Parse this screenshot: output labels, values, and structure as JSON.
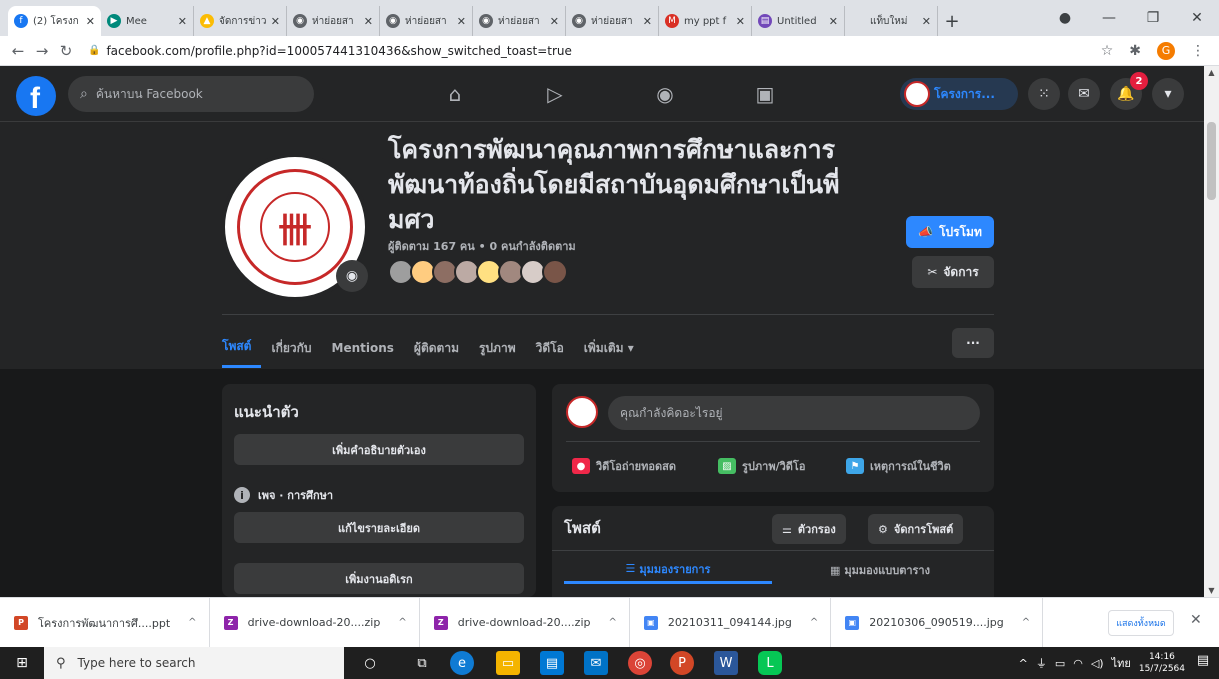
{
  "browser": {
    "tabs": [
      {
        "title": "(2) โครงก",
        "color": "#1877f2",
        "glyph": "f",
        "active": true
      },
      {
        "title": "Mee",
        "color": "#00897b",
        "glyph": "▶",
        "active": false
      },
      {
        "title": "จัดการข่าว",
        "color": "#fbbc04",
        "glyph": "▲",
        "active": false
      },
      {
        "title": "ห่าย่อยสา",
        "color": "#5f6368",
        "glyph": "◉",
        "active": false
      },
      {
        "title": "ห่าย่อยสา",
        "color": "#5f6368",
        "glyph": "◉",
        "active": false
      },
      {
        "title": "ห่าย่อยสา",
        "color": "#5f6368",
        "glyph": "◉",
        "active": false
      },
      {
        "title": "ห่าย่อยสา",
        "color": "#5f6368",
        "glyph": "◉",
        "active": false
      },
      {
        "title": "my ppt f",
        "color": "#d93025",
        "glyph": "M",
        "active": false
      },
      {
        "title": "Untitled",
        "color": "#7248b9",
        "glyph": "▤",
        "active": false
      },
      {
        "title": "แท็บใหม่",
        "color": "#dee1e6",
        "glyph": "",
        "active": false
      }
    ],
    "url": "facebook.com/profile.php?id=100057441310436&show_switched_toast=true",
    "profile_initial": "G"
  },
  "fb": {
    "search_placeholder": "ค้นหาบน Facebook",
    "page_switch_label": "โครงการ...",
    "notif_count": "2"
  },
  "profile": {
    "name": "โครงการพัฒนาคุณภาพการศึกษาและการพัฒนาท้องถิ่นโดยมีสถาบันอุดมศึกษาเป็นพี่ มศว",
    "followers": "ผู้ติดตาม 167 คน • 0 คนกำลังติดตาม",
    "promote_label": "โปรโมท",
    "manage_label": "จัดการ",
    "tabs": [
      "โพสต์",
      "เกี่ยวกับ",
      "Mentions",
      "ผู้ติดตาม",
      "รูปภาพ",
      "วิดีโอ",
      "เพิ่มเติม ▾"
    ],
    "more_label": "···"
  },
  "intro": {
    "title": "แนะนำตัว",
    "add_bio": "เพิ่มคำอธิบายตัวเอง",
    "category": "เพจ · การศึกษา",
    "edit_details": "แก้ไขรายละเอียด",
    "add_hobbies": "เพิ่มงานอดิเรก"
  },
  "composer": {
    "placeholder": "คุณกำลังคิดอะไรอยู่",
    "live": "วิดีโอถ่ายทอดสด",
    "photo": "รูปภาพ/วิดีโอ",
    "life_event": "เหตุการณ์ในชีวิต"
  },
  "posts": {
    "title": "โพสต์",
    "filter": "ตัวกรอง",
    "manage": "จัดการโพสต์",
    "list_view": "มุมมองรายการ",
    "grid_view": "มุมมองแบบตาราง"
  },
  "downloads": {
    "items": [
      {
        "name": "โครงการพัฒนาการศึ....ppt",
        "color": "#d24726",
        "glyph": "P"
      },
      {
        "name": "drive-download-20....zip",
        "color": "#8e24aa",
        "glyph": "Z"
      },
      {
        "name": "drive-download-20....zip",
        "color": "#8e24aa",
        "glyph": "Z"
      },
      {
        "name": "20210311_094144.jpg",
        "color": "#4285f4",
        "glyph": "▣"
      },
      {
        "name": "20210306_090519....jpg",
        "color": "#4285f4",
        "glyph": "▣"
      }
    ],
    "show_all": "แสดงทั้งหมด"
  },
  "taskbar": {
    "search_placeholder": "Type here to search",
    "lang": "ไทย",
    "time": "14:16",
    "date": "15/7/2564",
    "notif": "3"
  }
}
